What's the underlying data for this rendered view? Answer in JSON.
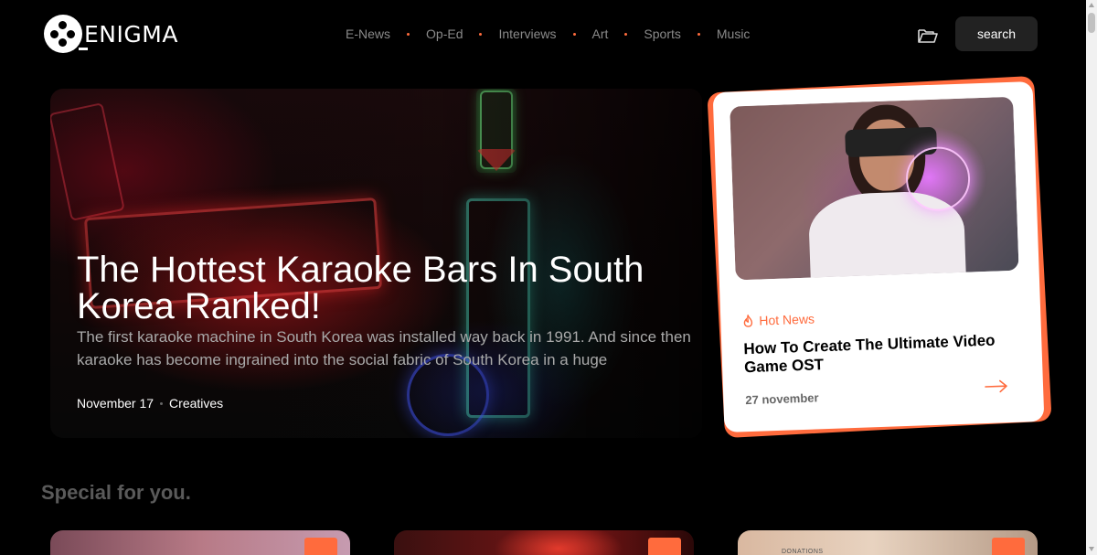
{
  "brand": {
    "name": "ENIGMA"
  },
  "nav": {
    "items": [
      {
        "label": "E-News"
      },
      {
        "label": "Op-Ed"
      },
      {
        "label": "Interviews"
      },
      {
        "label": "Art"
      },
      {
        "label": "Sports"
      },
      {
        "label": "Music"
      }
    ]
  },
  "header": {
    "search_label": "search",
    "folder_icon": "folder-open-icon"
  },
  "hero": {
    "title": "The Hottest Karaoke Bars In South Korea Ranked!",
    "excerpt": "The first karaoke machine in South Korea was installed way back in 1991. And since then karaoke has become ingrained into the social fabric of South Korea in a huge",
    "date": "November 17",
    "category": "Creatives"
  },
  "hot_news": {
    "tag": "Hot News",
    "title": "How To Create The Ultimate Video Game OST",
    "date": "27 november",
    "icon": "flame-icon",
    "arrow_icon": "arrow-right-icon"
  },
  "special": {
    "title": "Special for you.",
    "cards": [
      {
        "id": "c1",
        "caption": ""
      },
      {
        "id": "c2",
        "caption": ""
      },
      {
        "id": "c3",
        "caption": "DONATIONS"
      }
    ]
  },
  "colors": {
    "accent": "#ff6b3d",
    "background": "#000000",
    "card": "#ffffff",
    "button": "#222222"
  }
}
